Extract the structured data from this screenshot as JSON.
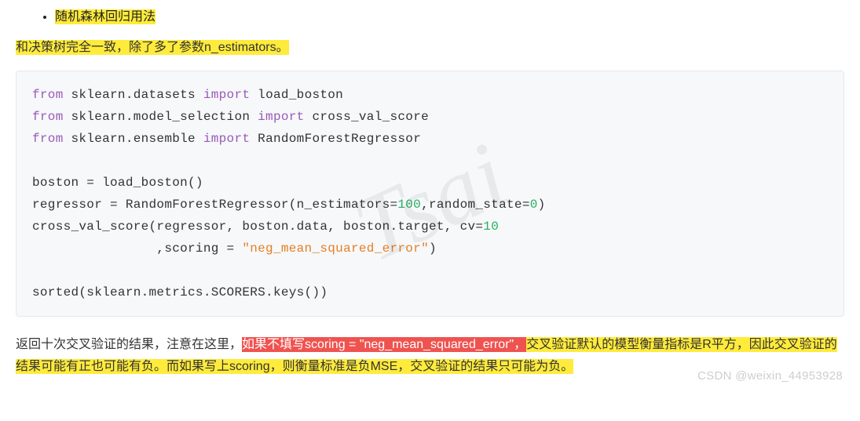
{
  "bullet": {
    "item": "随机森林回归用法"
  },
  "para1": {
    "line": "和决策树完全一致，除了多了参数n_estimators。"
  },
  "code": {
    "kw_from1": "from",
    "mod1": " sklearn.datasets ",
    "kw_import1": "import",
    "name1": " load_boston",
    "kw_from2": "from",
    "mod2": " sklearn.model_selection ",
    "kw_import2": "import",
    "name2": " cross_val_score",
    "kw_from3": "from",
    "mod3": " sklearn.ensemble ",
    "kw_import3": "import",
    "name3": " RandomForestRegressor",
    "l5": "boston = load_boston()",
    "l6a": "regressor = RandomForestRegressor(n_estimators=",
    "l6n1": "100",
    "l6b": ",random_state=",
    "l6n2": "0",
    "l6c": ")",
    "l7a": "cross_val_score(regressor, boston.data, boston.target, cv=",
    "l7n": "10",
    "l8a": "                ,scoring = ",
    "l8s": "\"neg_mean_squared_error\"",
    "l8b": ")",
    "l10": "sorted(sklearn.metrics.SCORERS.keys())"
  },
  "para2": {
    "pre": "返回十次交叉验证的结果，注意在这里，",
    "red": "如果不填写scoring = \"neg_mean_squared_error\"，",
    "y1": "交叉验证默认的模型衡量指标是R平方，因此交叉验证的结果可能有正也可能有负。",
    "mid": "而如果写上scoring，则衡量标准是负MSE，交叉验证的结果只可能为负。"
  },
  "watermark": "Tsai",
  "csdn": "CSDN @weixin_44953928"
}
